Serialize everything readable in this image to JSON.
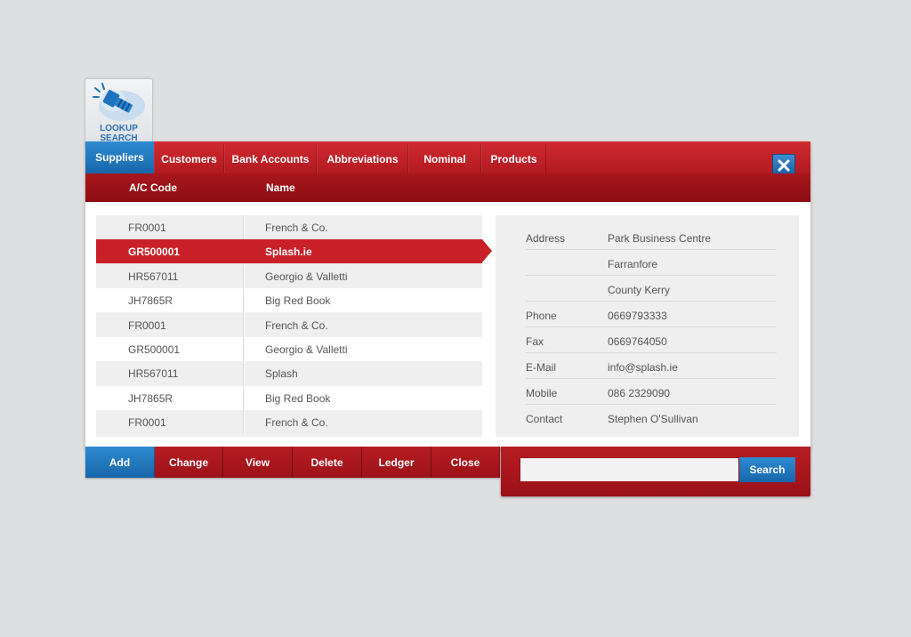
{
  "logo": {
    "line1": "LOOKUP",
    "line2": "SEARCH",
    "icon": "flashlight-icon"
  },
  "tabs": [
    {
      "label": "Suppliers",
      "active": true
    },
    {
      "label": "Customers",
      "active": false
    },
    {
      "label": "Bank Accounts",
      "active": false
    },
    {
      "label": "Abbreviations",
      "active": false
    },
    {
      "label": "Nominal",
      "active": false
    },
    {
      "label": "Products",
      "active": false
    }
  ],
  "close_icon": "close-icon",
  "columns": {
    "code": "A/C Code",
    "name": "Name"
  },
  "rows": [
    {
      "code": "FR0001",
      "name": "French & Co."
    },
    {
      "code": "GR500001",
      "name": "Splash.ie",
      "selected": true
    },
    {
      "code": "HR567011",
      "name": "Georgio & Valletti"
    },
    {
      "code": "JH7865R",
      "name": "Big Red Book"
    },
    {
      "code": "FR0001",
      "name": "French & Co."
    },
    {
      "code": "GR500001",
      "name": "Georgio & Valletti"
    },
    {
      "code": "HR567011",
      "name": "Splash"
    },
    {
      "code": "JH7865R",
      "name": "Big Red Book"
    },
    {
      "code": "FR0001",
      "name": "French & Co."
    }
  ],
  "details": [
    {
      "label": "Address",
      "value": "Park Business Centre"
    },
    {
      "label": "",
      "value": "Farranfore"
    },
    {
      "label": "",
      "value": "County Kerry"
    },
    {
      "label": "Phone",
      "value": "0669793333"
    },
    {
      "label": "Fax",
      "value": "0669764050"
    },
    {
      "label": "E-Mail",
      "value": "info@splash.ie"
    },
    {
      "label": "Mobile",
      "value": "086 2329090"
    },
    {
      "label": "Contact",
      "value": "Stephen O'Sullivan"
    }
  ],
  "actions": [
    "Add",
    "Change",
    "View",
    "Delete",
    "Ledger",
    "Close"
  ],
  "search": {
    "value": "",
    "placeholder": "",
    "button_label": "Search"
  },
  "colors": {
    "red": "#c92028",
    "dark_red": "#8c0e14",
    "blue": "#1f74bd"
  }
}
